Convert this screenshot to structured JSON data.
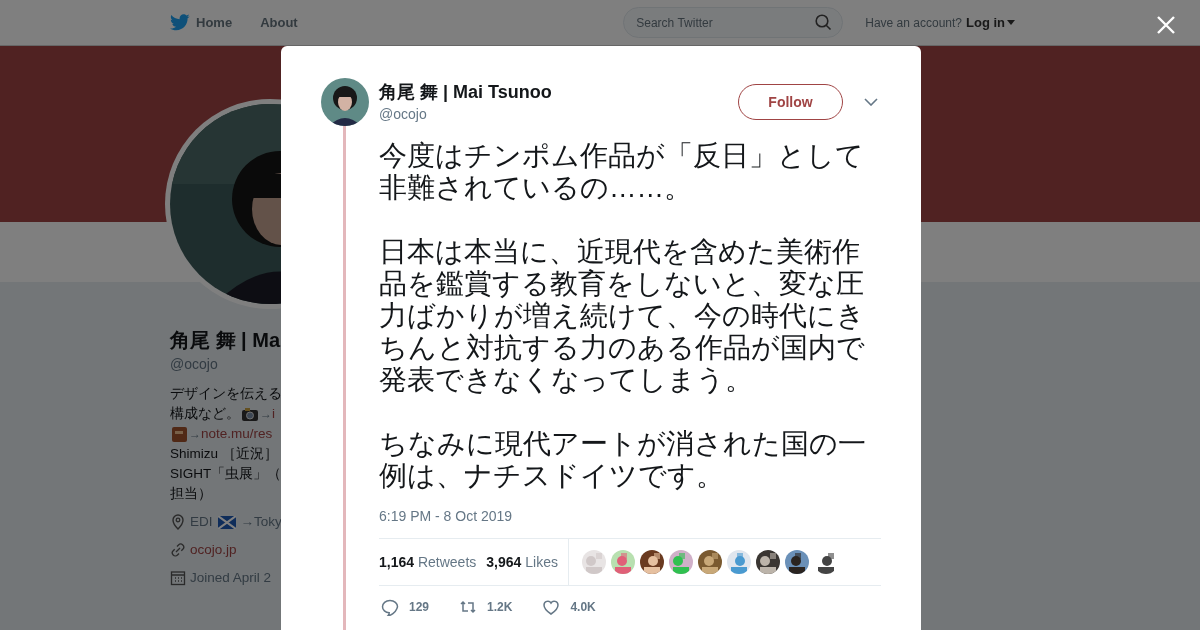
{
  "navbar": {
    "links": [
      {
        "label": "Home",
        "kind": "home"
      },
      {
        "label": "About",
        "kind": "plain"
      }
    ],
    "search": {
      "placeholder": "Search Twitter"
    },
    "account_prompt": "Have an account?",
    "login": "Log in"
  },
  "profile": {
    "name": "角尾 舞 | Ma",
    "handle": "@ocojo",
    "bio": [
      {
        "kind": "text",
        "text": "デザインを伝える"
      },
      {
        "kind": "camera",
        "before": "構成など。",
        "arrow": "→",
        "link": "i"
      },
      {
        "kind": "book",
        "arrow": "→",
        "link": "note.mu/res"
      },
      {
        "kind": "text",
        "text": "Shimizu ［近況］"
      },
      {
        "kind": "text",
        "text": "SIGHT「虫展」（"
      },
      {
        "kind": "text",
        "text": "担当）"
      }
    ],
    "location": {
      "before": "EDI",
      "after": "→Toky"
    },
    "website": "ocojo.jp",
    "joined": "Joined April 2"
  },
  "tweet": {
    "name": "角尾 舞 | Mai Tsunoo",
    "handle": "@ocojo",
    "follow": "Follow",
    "paragraphs": [
      "今度はチンポム作品が「反日」として非難されているの……。",
      "日本は本当に、近現代を含めた美術作品を鑑賞する教育をしないと、変な圧力ばかりが増え続けて、今の時代にきちんと対抗する力のある作品が国内で発表できなくなってしまう。",
      "ちなみに現代アートが消された国の一例は、ナチスドイツです。"
    ],
    "timestamp": "6:19 PM - 8 Oct 2019",
    "stats": [
      {
        "count": "1,164",
        "label": "Retweets"
      },
      {
        "count": "3,964",
        "label": "Likes"
      }
    ],
    "actions": [
      {
        "kind": "reply",
        "count": "129"
      },
      {
        "kind": "retweet",
        "count": "1.2K"
      },
      {
        "kind": "like",
        "count": "4.0K"
      }
    ]
  }
}
